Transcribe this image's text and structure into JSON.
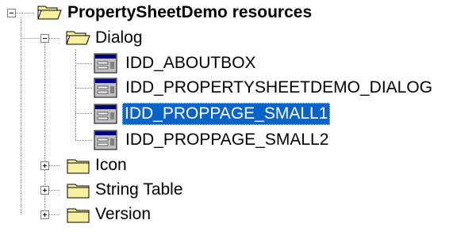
{
  "tree": {
    "root": {
      "label": "PropertySheetDemo resources",
      "icon": "open-folder-icon",
      "expanded": true
    },
    "dialog": {
      "label": "Dialog",
      "icon": "open-folder-icon",
      "expanded": true,
      "items": [
        {
          "label": "IDD_ABOUTBOX",
          "icon": "dialog-resource-icon",
          "selected": false
        },
        {
          "label": "IDD_PROPERTYSHEETDEMO_DIALOG",
          "icon": "dialog-resource-icon",
          "selected": false
        },
        {
          "label": "IDD_PROPPAGE_SMALL1",
          "icon": "dialog-resource-icon",
          "selected": true
        },
        {
          "label": "IDD_PROPPAGE_SMALL2",
          "icon": "dialog-resource-icon",
          "selected": false
        }
      ]
    },
    "icon_folder": {
      "label": "Icon",
      "icon": "closed-folder-icon",
      "expanded": false
    },
    "string_table": {
      "label": "String Table",
      "icon": "closed-folder-icon",
      "expanded": false
    },
    "version": {
      "label": "Version",
      "icon": "closed-folder-icon",
      "expanded": false
    }
  },
  "colors": {
    "selection_bg": "#0a64c8",
    "selection_text": "#ffffff",
    "folder_yellow": "#f8f0a0",
    "tree_lines": "#808080"
  }
}
